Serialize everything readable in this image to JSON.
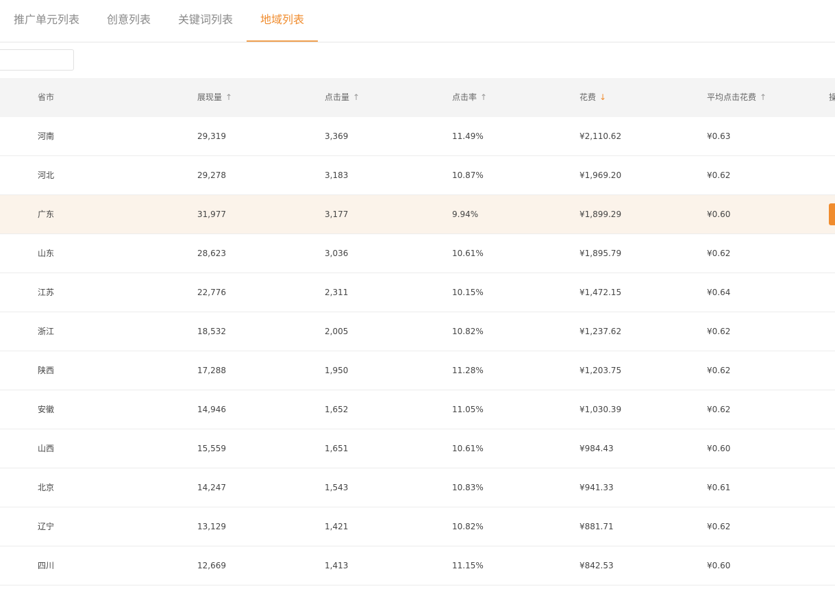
{
  "tabs": [
    {
      "label": "推广单元列表"
    },
    {
      "label": "创意列表"
    },
    {
      "label": "关键词列表"
    },
    {
      "label": "地域列表"
    }
  ],
  "active_tab": 3,
  "search": {
    "value": "",
    "placeholder": ""
  },
  "table": {
    "headers": {
      "province": "省市",
      "impressions": "展现量",
      "clicks": "点击量",
      "ctr": "点击率",
      "cost": "花费",
      "avg_cpc": "平均点击花费",
      "op_partial": "操"
    },
    "sort_icons": {
      "up": "↑",
      "down": "↓"
    },
    "rows": [
      {
        "province": "河南",
        "impressions": "29,319",
        "clicks": "3,369",
        "ctr": "11.49%",
        "cost": "¥2,110.62",
        "avg_cpc": "¥0.63"
      },
      {
        "province": "河北",
        "impressions": "29,278",
        "clicks": "3,183",
        "ctr": "10.87%",
        "cost": "¥1,969.20",
        "avg_cpc": "¥0.62"
      },
      {
        "province": "广东",
        "impressions": "31,977",
        "clicks": "3,177",
        "ctr": "9.94%",
        "cost": "¥1,899.29",
        "avg_cpc": "¥0.60"
      },
      {
        "province": "山东",
        "impressions": "28,623",
        "clicks": "3,036",
        "ctr": "10.61%",
        "cost": "¥1,895.79",
        "avg_cpc": "¥0.62"
      },
      {
        "province": "江苏",
        "impressions": "22,776",
        "clicks": "2,311",
        "ctr": "10.15%",
        "cost": "¥1,472.15",
        "avg_cpc": "¥0.64"
      },
      {
        "province": "浙江",
        "impressions": "18,532",
        "clicks": "2,005",
        "ctr": "10.82%",
        "cost": "¥1,237.62",
        "avg_cpc": "¥0.62"
      },
      {
        "province": "陕西",
        "impressions": "17,288",
        "clicks": "1,950",
        "ctr": "11.28%",
        "cost": "¥1,203.75",
        "avg_cpc": "¥0.62"
      },
      {
        "province": "安徽",
        "impressions": "14,946",
        "clicks": "1,652",
        "ctr": "11.05%",
        "cost": "¥1,030.39",
        "avg_cpc": "¥0.62"
      },
      {
        "province": "山西",
        "impressions": "15,559",
        "clicks": "1,651",
        "ctr": "10.61%",
        "cost": "¥984.43",
        "avg_cpc": "¥0.60"
      },
      {
        "province": "北京",
        "impressions": "14,247",
        "clicks": "1,543",
        "ctr": "10.83%",
        "cost": "¥941.33",
        "avg_cpc": "¥0.61"
      },
      {
        "province": "辽宁",
        "impressions": "13,129",
        "clicks": "1,421",
        "ctr": "10.82%",
        "cost": "¥881.71",
        "avg_cpc": "¥0.62"
      },
      {
        "province": "四川",
        "impressions": "12,669",
        "clicks": "1,413",
        "ctr": "11.15%",
        "cost": "¥842.53",
        "avg_cpc": "¥0.60"
      }
    ],
    "hovered_row": 2
  },
  "colors": {
    "accent": "#f08c2e",
    "header_bg": "#f4f4f4",
    "hover_row_bg": "#fbf3ea"
  }
}
